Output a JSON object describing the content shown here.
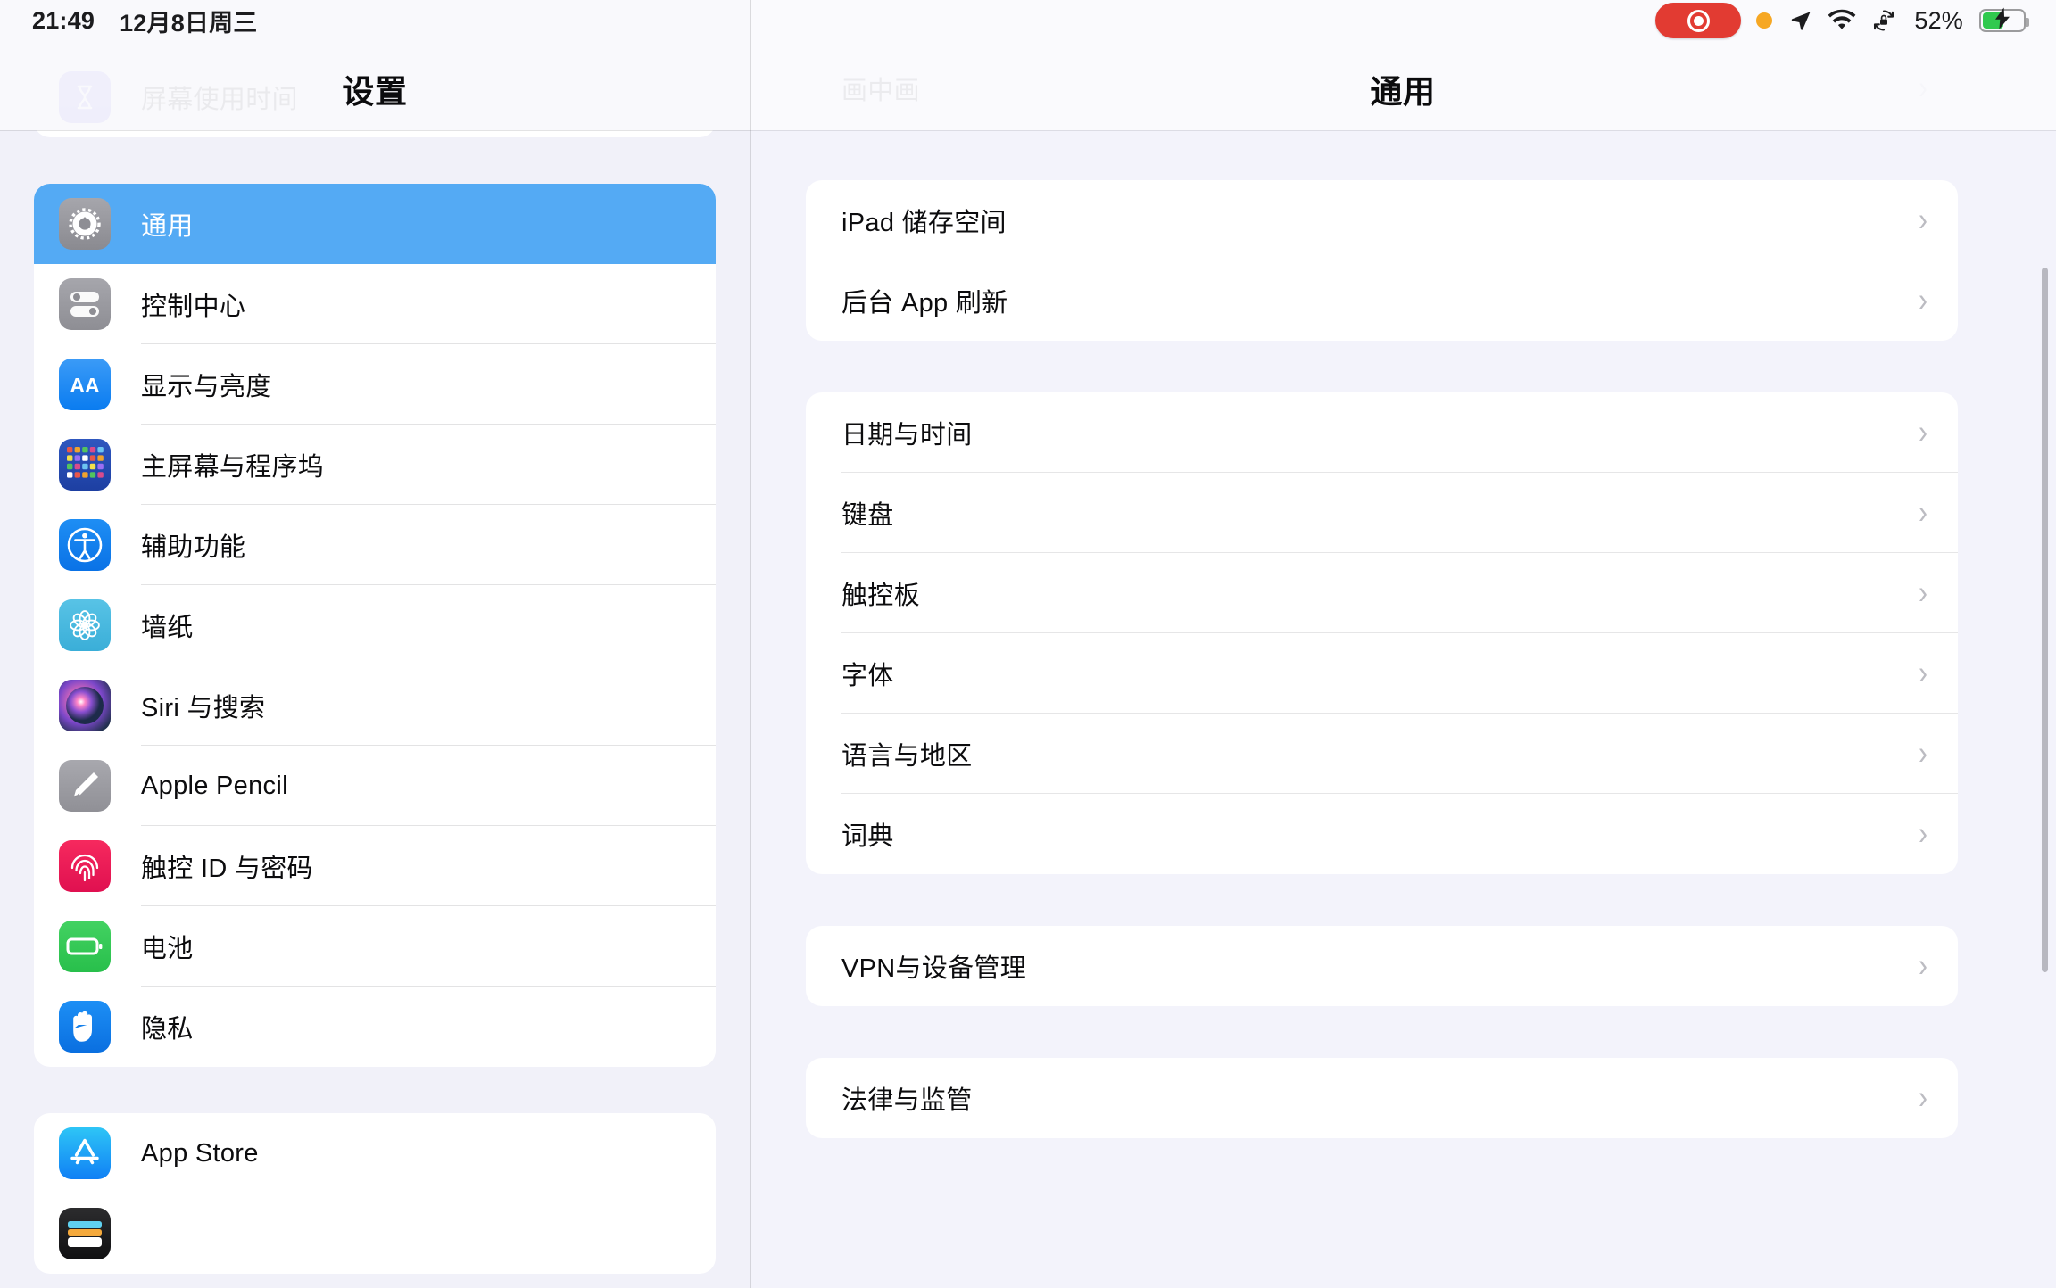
{
  "statusbar": {
    "time": "21:49",
    "date": "12月8日周三",
    "battery_percent": "52%",
    "icons": {
      "screen_record": "screen-record-pill",
      "mic_in_use": "orange-dot",
      "location": "location-arrow",
      "wifi": "wifi",
      "rotation_lock": "rotation-lock",
      "battery": "battery-charging"
    },
    "colors": {
      "record_red": "#e23b32",
      "mic_orange": "#f6a723",
      "battery_green": "#30c94e"
    }
  },
  "sidebar": {
    "title": "设置",
    "accent": "#54aaf4",
    "groups": [
      {
        "items": [
          {
            "label": "屏幕使用时间",
            "icon": "hourglass-icon",
            "icon_class": "ic-screentime",
            "selected": false
          }
        ]
      },
      {
        "items": [
          {
            "label": "通用",
            "icon": "gear-icon",
            "icon_class": "ic-gear",
            "selected": true
          },
          {
            "label": "控制中心",
            "icon": "toggles-icon",
            "icon_class": "ic-control",
            "selected": false
          },
          {
            "label": "显示与亮度",
            "icon": "aa-icon",
            "icon_class": "ic-display",
            "selected": false
          },
          {
            "label": "主屏幕与程序坞",
            "icon": "app-grid-icon",
            "icon_class": "ic-home",
            "selected": false
          },
          {
            "label": "辅助功能",
            "icon": "accessibility-icon",
            "icon_class": "ic-access",
            "selected": false
          },
          {
            "label": "墙纸",
            "icon": "flower-icon",
            "icon_class": "ic-wallpaper",
            "selected": false
          },
          {
            "label": "Siri 与搜索",
            "icon": "siri-orb-icon",
            "icon_class": "ic-siri",
            "selected": false
          },
          {
            "label": "Apple Pencil",
            "icon": "pencil-icon",
            "icon_class": "ic-pencil",
            "selected": false
          },
          {
            "label": "触控 ID 与密码",
            "icon": "fingerprint-icon",
            "icon_class": "ic-touchid",
            "selected": false
          },
          {
            "label": "电池",
            "icon": "battery-icon",
            "icon_class": "ic-battery",
            "selected": false
          },
          {
            "label": "隐私",
            "icon": "hand-icon",
            "icon_class": "ic-privacy",
            "selected": false
          }
        ]
      },
      {
        "items": [
          {
            "label": "App Store",
            "icon": "app-store-icon",
            "icon_class": "ic-appstore",
            "selected": false
          },
          {
            "label": "",
            "icon": "wallet-icon",
            "icon_class": "ic-wallet",
            "selected": false
          }
        ]
      }
    ]
  },
  "detail": {
    "title": "通用",
    "groups": [
      {
        "items": [
          {
            "label": "画中画",
            "chevron": "chevron-right-icon"
          }
        ]
      },
      {
        "items": [
          {
            "label": "iPad 储存空间",
            "chevron": "chevron-right-icon"
          },
          {
            "label": "后台 App 刷新",
            "chevron": "chevron-right-icon"
          }
        ]
      },
      {
        "items": [
          {
            "label": "日期与时间",
            "chevron": "chevron-right-icon"
          },
          {
            "label": "键盘",
            "chevron": "chevron-right-icon"
          },
          {
            "label": "触控板",
            "chevron": "chevron-right-icon"
          },
          {
            "label": "字体",
            "chevron": "chevron-right-icon"
          },
          {
            "label": "语言与地区",
            "chevron": "chevron-right-icon"
          },
          {
            "label": "词典",
            "chevron": "chevron-right-icon"
          }
        ]
      },
      {
        "items": [
          {
            "label": "VPN与设备管理",
            "chevron": "chevron-right-icon"
          }
        ]
      },
      {
        "items": [
          {
            "label": "法律与监管",
            "chevron": "chevron-right-icon"
          }
        ]
      }
    ],
    "chevron_glyph": "›"
  }
}
